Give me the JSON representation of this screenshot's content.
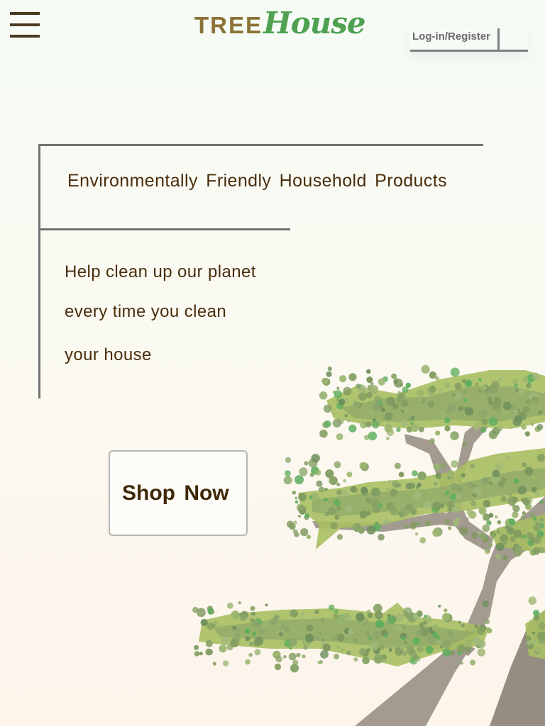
{
  "header": {
    "logo_part1": "TREE",
    "logo_part2": "House",
    "login_label": "Log-in/Register"
  },
  "hero": {
    "headline": "Environmentally Friendly Household Products",
    "tagline_lines": [
      "Help clean up our planet",
      "every time you clean",
      "your house"
    ],
    "cta_label": "Shop Now"
  },
  "icons": {
    "menu": "hamburger-menu-icon"
  },
  "colors": {
    "logo_tree": "#8b7336",
    "logo_house": "#4fa151",
    "text": "#4a2e0c",
    "frame": "#707373",
    "trunk": "#9e958c",
    "foliage_light": "#a8bf63",
    "foliage_dark": "#7f9a60"
  }
}
